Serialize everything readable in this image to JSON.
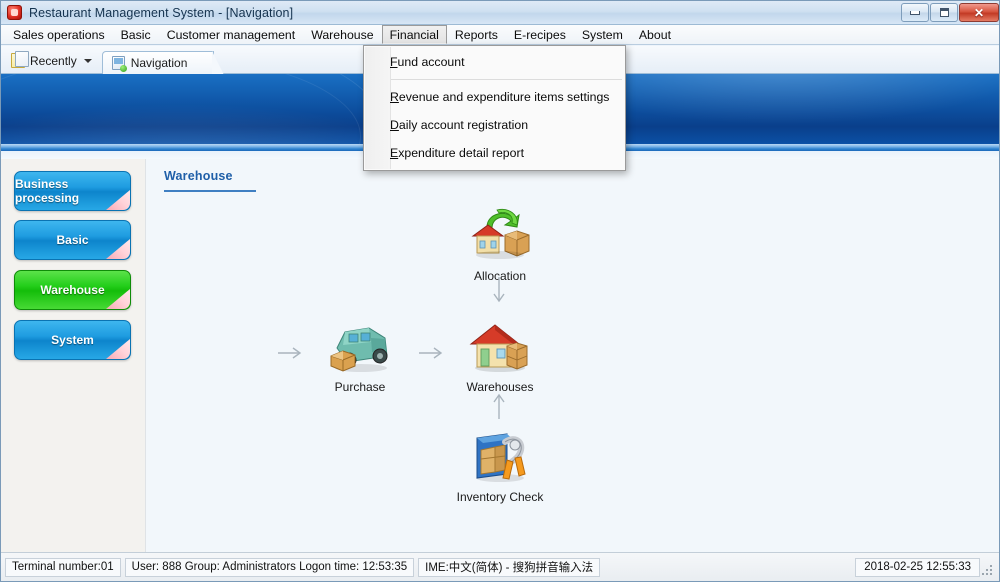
{
  "window": {
    "title": "Restaurant Management System - [Navigation]",
    "app_icon": "app-logo-icon",
    "controls": {
      "minimize": "minimize-button",
      "maximize": "maximize-button",
      "close": "✕"
    }
  },
  "menubar": {
    "items": [
      {
        "label": "Sales operations",
        "active": false
      },
      {
        "label": "Basic",
        "active": false
      },
      {
        "label": "Customer management",
        "active": false
      },
      {
        "label": "Warehouse",
        "active": false
      },
      {
        "label": "Financial",
        "active": true
      },
      {
        "label": "Reports",
        "active": false
      },
      {
        "label": "E-recipes",
        "active": false
      },
      {
        "label": "System",
        "active": false
      },
      {
        "label": "About",
        "active": false
      }
    ]
  },
  "dropdown": {
    "open_for": "Financial",
    "items": [
      {
        "label": "Fund account",
        "accel": "F"
      },
      {
        "label": "Revenue and expenditure items settings",
        "accel": "R"
      },
      {
        "label": "Daily account registration",
        "accel": "D"
      },
      {
        "label": "Expenditure detail report",
        "accel": "E"
      }
    ]
  },
  "tabstrip": {
    "recently_label": "Recently",
    "recently_icon": "documents-icon",
    "caret_icon": "chevron-down-icon",
    "tabs": [
      {
        "label": "Navigation",
        "icon": "page-new-icon",
        "active": true
      }
    ]
  },
  "sidebar": {
    "buttons": [
      {
        "label": "Business processing",
        "color": "#1e9ce0",
        "selected": false
      },
      {
        "label": "Basic",
        "color": "#1e9ce0",
        "selected": false
      },
      {
        "label": "Warehouse",
        "color": "#25cf1c",
        "selected": true
      },
      {
        "label": "System",
        "color": "#1e9ce0",
        "selected": false
      }
    ]
  },
  "content": {
    "section_title": "Warehouse",
    "nodes": [
      {
        "id": "allocation",
        "label": "Allocation",
        "icon": "house-exchange-box-icon"
      },
      {
        "id": "purchase",
        "label": "Purchase",
        "icon": "truck-box-icon"
      },
      {
        "id": "warehouses",
        "label": "Warehouses",
        "icon": "house-boxes-icon"
      },
      {
        "id": "inventory-check",
        "label": "Inventory Check",
        "icon": "boxes-tools-icon"
      }
    ],
    "arrows": [
      {
        "id": "arrow-into-purchase",
        "dir": "right"
      },
      {
        "id": "arrow-purchase-to-warehouses",
        "dir": "right"
      },
      {
        "id": "arrow-allocation-to-warehouses",
        "dir": "down"
      },
      {
        "id": "arrow-inventory-to-warehouses",
        "dir": "up"
      }
    ]
  },
  "statusbar": {
    "terminal": "Terminal number:01",
    "user": "User: 888 Group: Administrators Logon time: 12:53:35",
    "ime": "IME:中文(简体) - 搜狗拼音输入法",
    "clock": "2018-02-25 12:55:33"
  }
}
